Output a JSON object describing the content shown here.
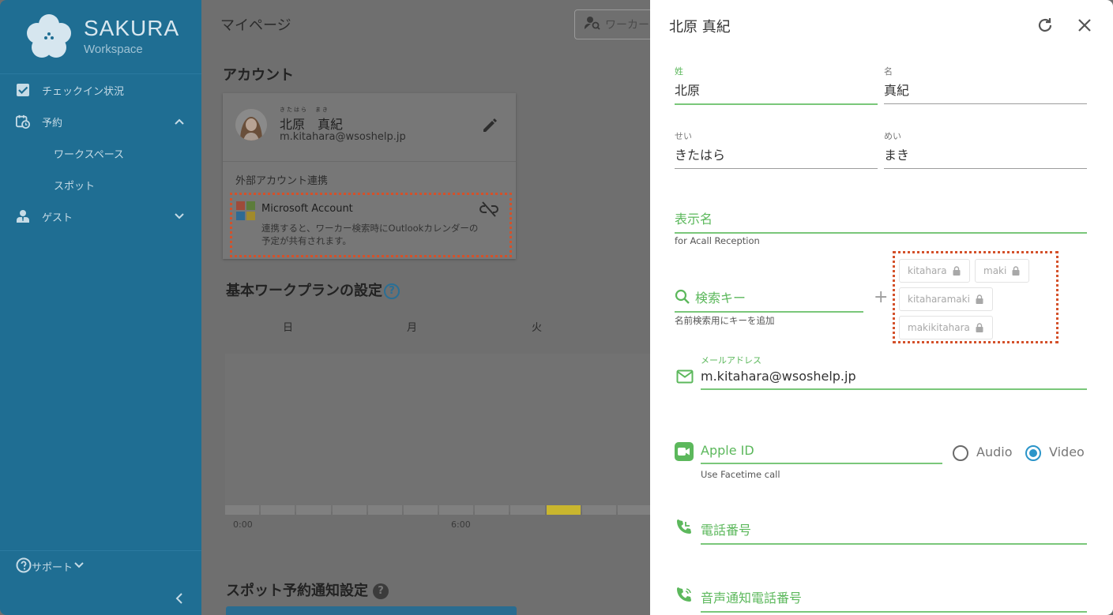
{
  "sidebar": {
    "logo_title": "SAKURA",
    "logo_subtitle": "Workspace",
    "items": [
      {
        "label": "チェックイン状況"
      },
      {
        "label": "予約"
      },
      {
        "label": "ワークスペース"
      },
      {
        "label": "スポット"
      },
      {
        "label": "ゲスト"
      }
    ],
    "support_label": "サポート"
  },
  "main": {
    "page_title": "マイページ",
    "search_placeholder": "ワーカー",
    "account_heading": "アカウント",
    "account": {
      "ruby": "きたはら　まき",
      "name": "北原　真紀",
      "email": "m.kitahara@wsoshelp.jp",
      "external_label": "外部アカウント連携",
      "ms_title": "Microsoft Account",
      "ms_desc": "連携すると、ワーカー検索時にOutlookカレンダーの予定が共有されます。"
    },
    "workplan_heading": "基本ワークプランの設定",
    "days": [
      "日",
      "月",
      "火"
    ],
    "times": [
      "0:00",
      "6:00"
    ],
    "spot_heading": "スポット予約通知設定"
  },
  "panel": {
    "title": "北原 真紀",
    "last_name_label": "姓",
    "last_name": "北原",
    "first_name_label": "名",
    "first_name": "真紀",
    "last_kana_label": "せい",
    "last_kana": "きたはら",
    "first_kana_label": "めい",
    "first_kana": "まき",
    "display_name_placeholder": "表示名",
    "display_name_hint": "for Acall Reception",
    "search_key_placeholder": "検索キー",
    "search_key_hint": "名前検索用にキーを追加",
    "chips": [
      "kitahara",
      "maki",
      "kitaharamaki",
      "makikitahara"
    ],
    "email_label": "メールアドレス",
    "email": "m.kitahara@wsoshelp.jp",
    "apple_id_placeholder": "Apple ID",
    "apple_id_hint": "Use Facetime call",
    "audio_label": "Audio",
    "video_label": "Video",
    "phone_placeholder": "電話番号",
    "voice_phone_placeholder": "音声通知電話番号"
  },
  "colors": {
    "sidebar": "#1f6e93",
    "accent_green": "#5cb85c",
    "radio_blue": "#2b95c9",
    "highlight_dotted": "#d4512a"
  }
}
